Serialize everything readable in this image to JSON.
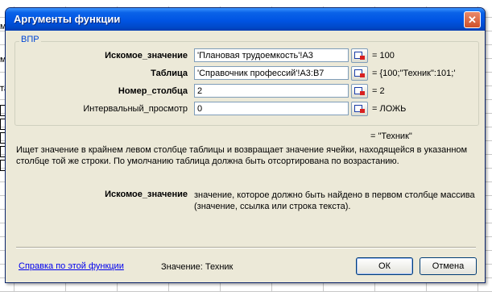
{
  "sheet": {
    "top_text": "…",
    "cells": [
      "мк",
      "",
      "мк",
      "",
      "та",
      ")",
      ")",
      ")",
      "9",
      ")"
    ]
  },
  "dialog": {
    "title": "Аргументы функции",
    "close_icon": "close-icon",
    "function_name": "ВПР",
    "args": [
      {
        "label": "Искомое_значение",
        "bold": true,
        "value": "'Плановая трудоемкость'!A3",
        "result": "= 100"
      },
      {
        "label": "Таблица",
        "bold": true,
        "value": "'Справочник профессий'!A3:B7",
        "result": "= {100;\"Техник\":101;'"
      },
      {
        "label": "Номер_столбца",
        "bold": true,
        "value": "2",
        "result": "= 2"
      },
      {
        "label": "Интервальный_просмотр",
        "bold": false,
        "value": "0",
        "result": "= ЛОЖЬ"
      }
    ],
    "function_result": "= \"Техник\"",
    "description": "Ищет значение в крайнем левом столбце таблицы и возвращает значение ячейки, находящейся в указанном столбце той же строки. По умолчанию таблица должна быть отсортирована по возрастанию.",
    "arg_help": {
      "name": "Искомое_значение",
      "text": "значение, которое должно быть найдено в первом столбце массива (значение, ссылка или строка текста)."
    },
    "help_link": "Справка по этой функции",
    "value_label": "Значение:",
    "value": "Техник",
    "ok_label": "ОК",
    "cancel_label": "Отмена"
  }
}
